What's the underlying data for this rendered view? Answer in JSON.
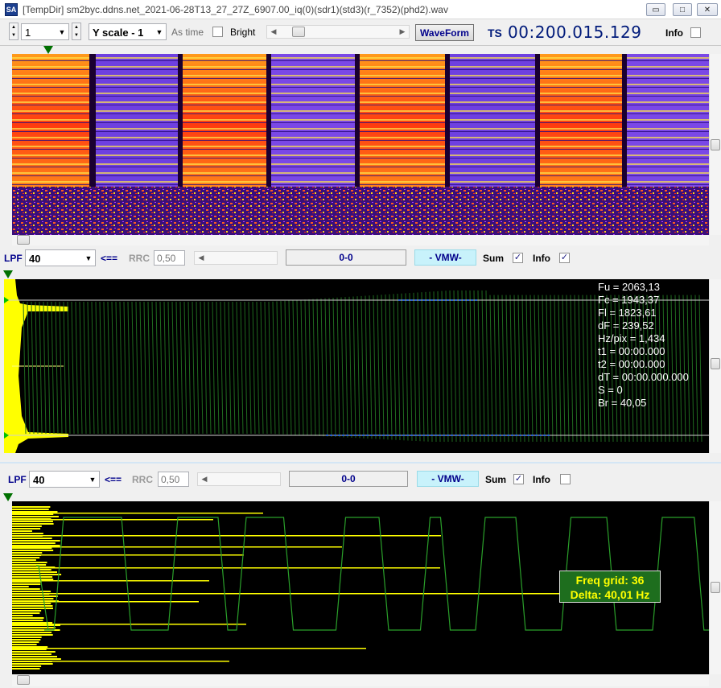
{
  "window": {
    "icon_text": "SA",
    "title": "[TempDir] sm2byc.ddns.net_2021-06-28T13_27_27Z_6907.00_iq(0)(sdr1)(std3)(r_7352)(phd2).wav",
    "min_glyph": "▭",
    "max_glyph": "□",
    "close_glyph": "✕"
  },
  "toolbar": {
    "channel_value": "1",
    "yscale_value": "Y scale - 1",
    "as_time_label": "As time",
    "bright_label": "Bright",
    "waveform_label": "WaveForm",
    "ts_label": "TS",
    "ts_value": "00:200.015.129",
    "info_label": "Info"
  },
  "filter1": {
    "lpf_label": "LPF",
    "lpf_value": "40",
    "arrow_label": "<==",
    "rrc_label": "RRC",
    "rrc_value": "0,50",
    "range_value": "0-0",
    "vmw_label": "- VMW-",
    "sum_label": "Sum",
    "sum_checked": true,
    "info_label": "Info",
    "info_checked": true
  },
  "wave_info": [
    "Fu = 2063,13",
    "Fc = 1943,37",
    "Fl = 1823,61",
    "dF = 239,52",
    "Hz/pix = 1,434",
    "t1 = 00:00.000",
    "t2 = 00:00.000",
    "dT = 00:00.000.000",
    "S = 0",
    "Br = 40,05"
  ],
  "filter2": {
    "lpf_label": "LPF",
    "lpf_value": "40",
    "arrow_label": "<==",
    "rrc_label": "RRC",
    "rrc_value": "0,50",
    "range_value": "0-0",
    "vmw_label": "- VMW-",
    "sum_label": "Sum",
    "sum_checked": true,
    "info_label": "Info",
    "info_checked": false
  },
  "freq_box": {
    "line1": "Freq grid: 36",
    "line2": "Delta: 40,01 Hz"
  },
  "colors": {
    "accent_blue": "#00008b",
    "ts_color": "#001a7a",
    "vmw_bg": "#c8f2fb",
    "wave_green": "#1f7a1f",
    "histogram_yellow": "#ffff00",
    "marker_green": "#007000",
    "freq_box_bg": "#1e6e1e",
    "freq_box_text": "#ffff00"
  }
}
